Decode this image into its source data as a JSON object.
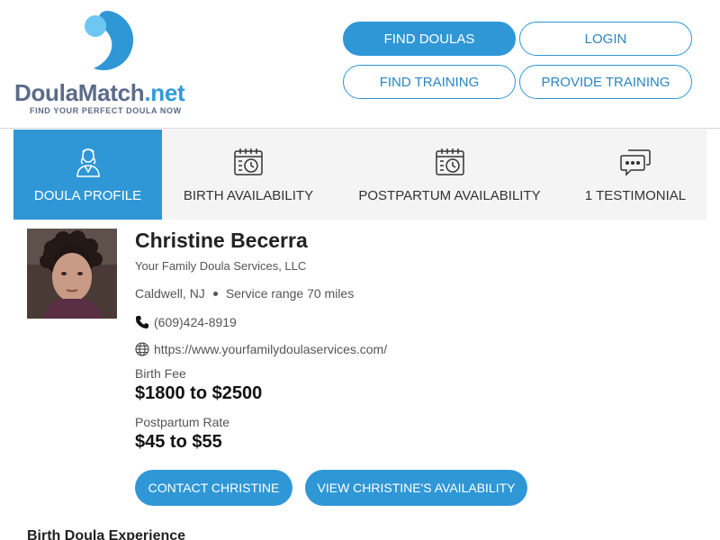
{
  "brand": {
    "name_main": "DoulaMatch",
    "name_suffix": ".net",
    "tagline": "FIND YOUR PERFECT DOULA NOW",
    "colors": {
      "primary": "#2f97d6",
      "light": "#6ec6f2",
      "text": "#5b6b88"
    }
  },
  "nav": {
    "find_doulas": "FIND DOULAS",
    "login": "LOGIN",
    "find_training": "FIND TRAINING",
    "provide_training": "PROVIDE TRAINING"
  },
  "tabs": [
    {
      "label": "DOULA PROFILE",
      "icon": "doula-person-icon",
      "active": true
    },
    {
      "label": "BIRTH AVAILABILITY",
      "icon": "calendar-clock-icon",
      "active": false
    },
    {
      "label": "POSTPARTUM AVAILABILITY",
      "icon": "calendar-clock-icon",
      "active": false
    },
    {
      "label": "1 TESTIMONIAL",
      "icon": "chat-bubbles-icon",
      "active": false
    }
  ],
  "profile": {
    "name": "Christine Becerra",
    "company": "Your Family Doula Services, LLC",
    "city": "Caldwell, NJ",
    "service_range": "Service range 70 miles",
    "phone": "(609)424-8919",
    "website": "https://www.yourfamilydoulaservices.com/",
    "birth_fee_label": "Birth Fee",
    "birth_fee": "$1800 to $2500",
    "postpartum_rate_label": "Postpartum Rate",
    "postpartum_rate": "$45 to $55",
    "contact_button": "CONTACT CHRISTINE",
    "availability_button": "VIEW CHRISTINE'S AVAILABILITY"
  },
  "sections": {
    "experience_title": "Birth Doula Experience"
  }
}
